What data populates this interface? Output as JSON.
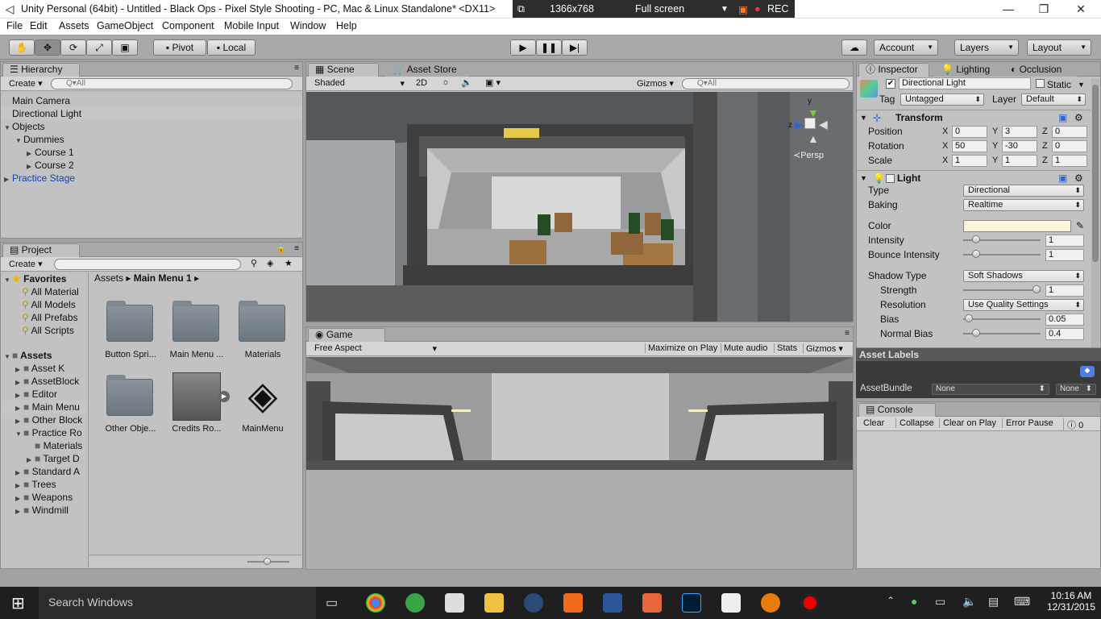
{
  "window": {
    "title": "Unity Personal (64bit) - Untitled - Black Ops - Pixel Style Shooting - PC, Mac & Linux Standalone* <DX11>",
    "rec": {
      "resolution": "1366x768",
      "mode": "Full screen",
      "rec_label": "REC"
    }
  },
  "menu": [
    "File",
    "Edit",
    "Assets",
    "GameObject",
    "Component",
    "Mobile Input",
    "Window",
    "Help"
  ],
  "toolbar": {
    "pivot": "Pivot",
    "local": "Local",
    "account": "Account",
    "layers": "Layers",
    "layout": "Layout"
  },
  "hierarchy": {
    "tab": "Hierarchy",
    "create": "Create",
    "search_placeholder": "Q▾All",
    "items": [
      {
        "label": "Main Camera",
        "depth": 0,
        "arrow": "",
        "selected": false,
        "prefab": false
      },
      {
        "label": "Directional Light",
        "depth": 0,
        "arrow": "",
        "selected": true,
        "prefab": false
      },
      {
        "label": "Objects",
        "depth": 0,
        "arrow": "▼",
        "selected": false,
        "prefab": false
      },
      {
        "label": "Dummies",
        "depth": 1,
        "arrow": "▼",
        "selected": false,
        "prefab": false
      },
      {
        "label": "Course 1",
        "depth": 2,
        "arrow": "▶",
        "selected": false,
        "prefab": false
      },
      {
        "label": "Course 2",
        "depth": 2,
        "arrow": "▶",
        "selected": false,
        "prefab": false
      },
      {
        "label": "Practice Stage",
        "depth": 0,
        "arrow": "▶",
        "selected": false,
        "prefab": true
      }
    ]
  },
  "project": {
    "tab": "Project",
    "create": "Create",
    "favorites_label": "Favorites",
    "favorites": [
      "All Material",
      "All Models",
      "All Prefabs",
      "All Scripts"
    ],
    "assets_label": "Assets",
    "folders": [
      {
        "label": "Asset K",
        "arrow": "▶",
        "depth": 0,
        "selected": false
      },
      {
        "label": "AssetBlock",
        "arrow": "▶",
        "depth": 0,
        "selected": false
      },
      {
        "label": "Editor",
        "arrow": "▶",
        "depth": 0,
        "selected": false
      },
      {
        "label": "Main Menu",
        "arrow": "▶",
        "depth": 0,
        "selected": true
      },
      {
        "label": "Other Block",
        "arrow": "▶",
        "depth": 0,
        "selected": false
      },
      {
        "label": "Practice Ro",
        "arrow": "▼",
        "depth": 0,
        "selected": false
      },
      {
        "label": "Materials",
        "arrow": "",
        "depth": 1,
        "selected": false
      },
      {
        "label": "Target D",
        "arrow": "▶",
        "depth": 1,
        "selected": false
      },
      {
        "label": "Standard A",
        "arrow": "▶",
        "depth": 0,
        "selected": false
      },
      {
        "label": "Trees",
        "arrow": "▶",
        "depth": 0,
        "selected": false
      },
      {
        "label": "Weapons",
        "arrow": "▶",
        "depth": 0,
        "selected": false
      },
      {
        "label": "Windmill",
        "arrow": "▶",
        "depth": 0,
        "selected": false
      }
    ],
    "breadcrumb": {
      "root": "Assets",
      "current": "Main Menu 1"
    },
    "grid": [
      {
        "label": "Button Spri...",
        "kind": "folder"
      },
      {
        "label": "Main Menu ...",
        "kind": "folder"
      },
      {
        "label": "Materials",
        "kind": "folder"
      },
      {
        "label": "Other Obje...",
        "kind": "folder"
      },
      {
        "label": "Credits Ro...",
        "kind": "prefab"
      },
      {
        "label": "MainMenu",
        "kind": "unity"
      }
    ]
  },
  "scene": {
    "tab": "Scene",
    "tab2": "Asset Store",
    "shaded": "Shaded",
    "mode2d": "2D",
    "gizmos": "Gizmos",
    "search_placeholder": "Q▾All",
    "persp": "Persp",
    "axis_y": "y",
    "axis_z": "z"
  },
  "game": {
    "tab": "Game",
    "aspect": "Free Aspect",
    "maximize": "Maximize on Play",
    "mute": "Mute audio",
    "stats": "Stats",
    "gizmos": "Gizmos"
  },
  "inspector": {
    "tabs": [
      "Inspector",
      "Lighting",
      "Occlusion"
    ],
    "object_name": "Directional Light",
    "static": "Static",
    "tag_label": "Tag",
    "tag": "Untagged",
    "layer_label": "Layer",
    "layer": "Default",
    "transform": {
      "title": "Transform",
      "rows": [
        {
          "label": "Position",
          "x": "0",
          "y": "3",
          "z": "0"
        },
        {
          "label": "Rotation",
          "x": "50",
          "y": "-30",
          "z": "0"
        },
        {
          "label": "Scale",
          "x": "1",
          "y": "1",
          "z": "1"
        }
      ]
    },
    "light": {
      "title": "Light",
      "type_label": "Type",
      "type": "Directional",
      "baking_label": "Baking",
      "baking": "Realtime",
      "color_label": "Color",
      "color": "#fbf4dc",
      "intensity_label": "Intensity",
      "intensity": "1",
      "intensity_frac": 0.125,
      "bounce_label": "Bounce Intensity",
      "bounce": "1",
      "bounce_frac": 0.125,
      "shadow_type_label": "Shadow Type",
      "shadow_type": "Soft Shadows",
      "strength_label": "Strength",
      "strength": "1",
      "strength_frac": 1.0,
      "resolution_label": "Resolution",
      "resolution": "Use Quality Settings",
      "bias_label": "Bias",
      "bias": "0.05",
      "bias_frac": 0.025,
      "normal_bias_label": "Normal Bias",
      "normal_bias": "0.4",
      "normal_bias_frac": 0.13
    },
    "asset_labels": "Asset Labels",
    "assetbundle_label": "AssetBundle",
    "assetbundle": "None",
    "assetbundle_variant": "None"
  },
  "console": {
    "tab": "Console",
    "buttons": [
      "Clear",
      "Collapse",
      "Clear on Play",
      "Error Pause"
    ],
    "count": "0"
  },
  "taskbar": {
    "search": "Search Windows",
    "time": "10:16 AM",
    "date": "12/31/2015"
  }
}
